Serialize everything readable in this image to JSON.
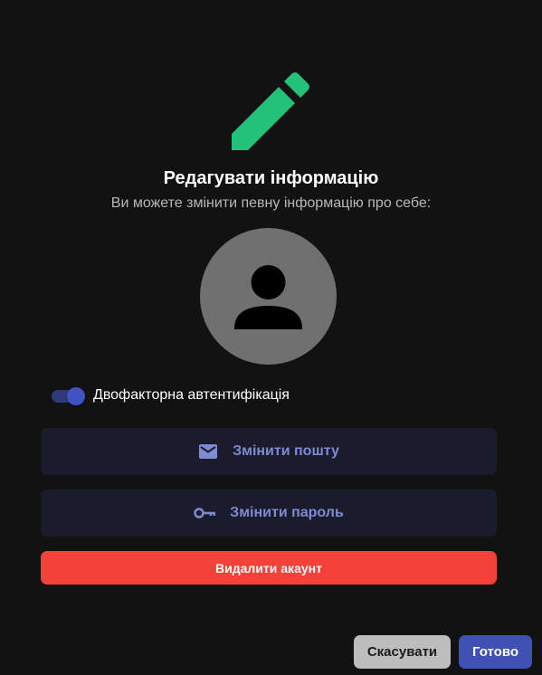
{
  "dialog": {
    "icon": "pencil-icon",
    "title": "Редагувати інформацію",
    "subtitle": "Ви можете змінити певну інформацію про себе:"
  },
  "avatar": {
    "icon": "person-icon"
  },
  "two_factor": {
    "label": "Двофакторна автентифікація",
    "enabled": true
  },
  "actions": {
    "change_email": {
      "label": "Змінити пошту",
      "icon": "mail-icon"
    },
    "change_password": {
      "label": "Змінити пароль",
      "icon": "key-icon"
    },
    "delete_account": {
      "label": "Видалити акаунт"
    }
  },
  "footer": {
    "cancel_label": "Скасувати",
    "done_label": "Готово"
  },
  "colors": {
    "background": "#121212",
    "accent_green": "#22c27a",
    "primary": "#3f51b5",
    "danger": "#f4413a",
    "secondary_button": "#bdbdbd",
    "action_button_bg": "#1a1c2e",
    "action_button_text": "#7f8ad1",
    "avatar_bg": "#707070"
  }
}
